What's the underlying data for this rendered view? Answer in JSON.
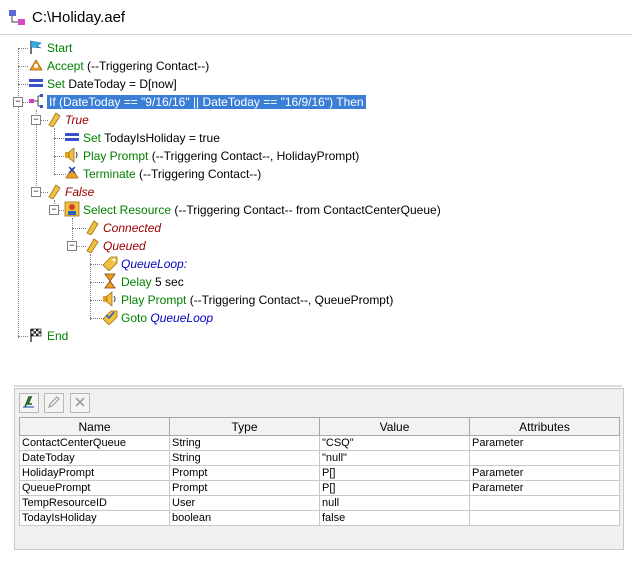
{
  "window": {
    "title": "C:\\Holiday.aef"
  },
  "tree": {
    "start": "Start",
    "accept_kw": "Accept",
    "accept_arg": " (--Triggering Contact--)",
    "set1_kw": "Set",
    "set1_expr": " DateToday = D[now]",
    "if_text": "If (DateToday == \"9/16/16\" || DateToday == \"16/9/16\") Then",
    "true_label": "True",
    "set2_kw": "Set",
    "set2_expr": " TodayIsHoliday = true",
    "play1_kw": "Play Prompt",
    "play1_arg": " (--Triggering Contact--, HolidayPrompt)",
    "term_kw": "Terminate",
    "term_arg": " (--Triggering Contact--)",
    "false_label": "False",
    "select_kw": "Select Resource",
    "select_arg": " (--Triggering Contact-- from ContactCenterQueue)",
    "connected": "Connected",
    "queued": "Queued",
    "queueloop_label": "QueueLoop:",
    "delay_kw": "Delay",
    "delay_arg": " 5 sec",
    "play2_kw": "Play Prompt",
    "play2_arg": " (--Triggering Contact--, QueuePrompt)",
    "goto_kw": "Goto",
    "goto_arg": "QueueLoop",
    "end": "End"
  },
  "variables": {
    "columns": [
      "Name",
      "Type",
      "Value",
      "Attributes"
    ],
    "rows": [
      [
        "ContactCenterQueue",
        "String",
        "\"CSQ\"",
        "Parameter"
      ],
      [
        "DateToday",
        "String",
        "\"null\"",
        ""
      ],
      [
        "HolidayPrompt",
        "Prompt",
        "P[]",
        "Parameter"
      ],
      [
        "QueuePrompt",
        "Prompt",
        "P[]",
        "Parameter"
      ],
      [
        "TempResourceID",
        "User",
        "null",
        ""
      ],
      [
        "TodayIsHoliday",
        "boolean",
        "false",
        ""
      ]
    ]
  },
  "icons": {
    "title": "workflow-icon",
    "start": "flag-icon",
    "accept": "accept-icon",
    "set": "set-icon",
    "if": "if-icon",
    "branch": "branch-icon",
    "play": "speaker-icon",
    "terminate": "terminate-icon",
    "select": "select-resource-icon",
    "label": "label-icon",
    "delay": "hourglass-icon",
    "goto": "goto-icon",
    "end": "end-flag-icon"
  }
}
